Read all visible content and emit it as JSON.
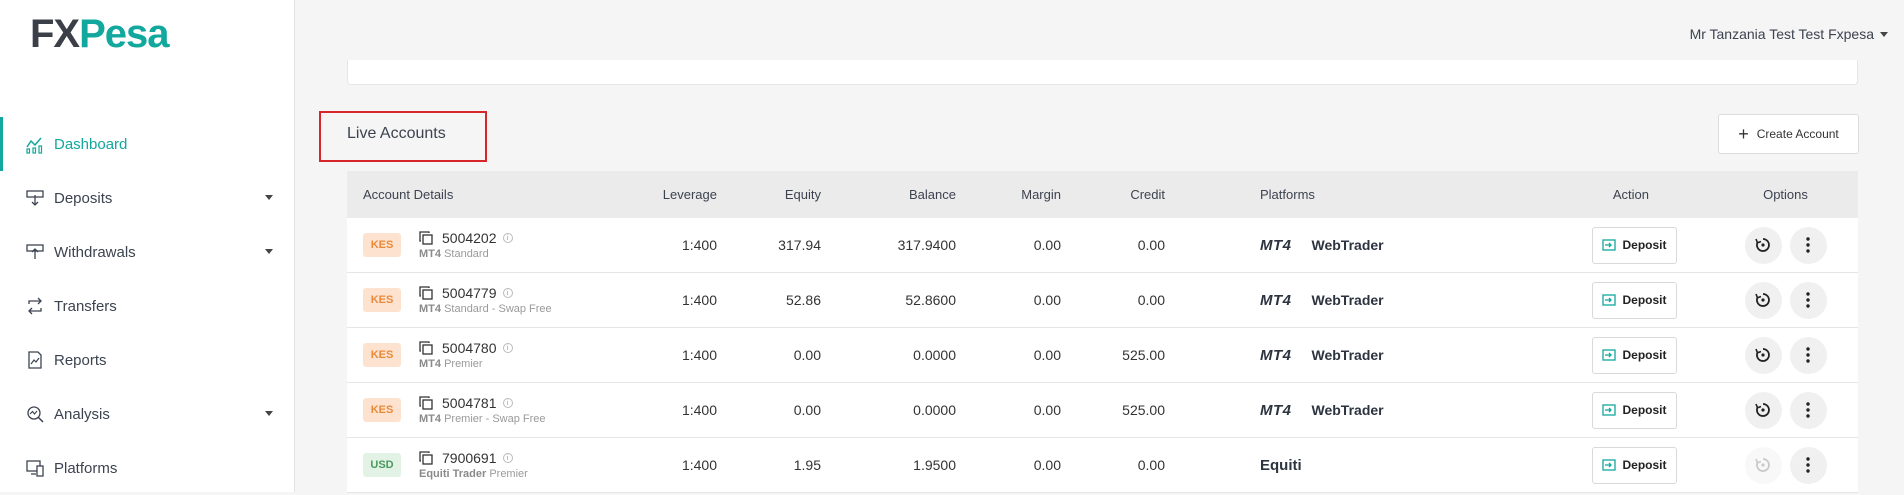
{
  "brand": {
    "logo_fx": "FX",
    "logo_pesa": "Pesa"
  },
  "user": {
    "name": "Mr Tanzania Test Test Fxpesa"
  },
  "sidebar": {
    "items": [
      {
        "label": "Dashboard",
        "icon": "dashboard-chart-icon",
        "active": true,
        "has_caret": false
      },
      {
        "label": "Deposits",
        "icon": "deposit-icon",
        "active": false,
        "has_caret": true
      },
      {
        "label": "Withdrawals",
        "icon": "withdrawal-icon",
        "active": false,
        "has_caret": true
      },
      {
        "label": "Transfers",
        "icon": "transfer-icon",
        "active": false,
        "has_caret": false
      },
      {
        "label": "Reports",
        "icon": "report-icon",
        "active": false,
        "has_caret": false
      },
      {
        "label": "Analysis",
        "icon": "analysis-icon",
        "active": false,
        "has_caret": true
      },
      {
        "label": "Platforms",
        "icon": "platforms-icon",
        "active": false,
        "has_caret": false
      }
    ]
  },
  "section": {
    "title": "Live Accounts",
    "create_button": "Create Account"
  },
  "table": {
    "headers": {
      "account": "Account Details",
      "leverage": "Leverage",
      "equity": "Equity",
      "balance": "Balance",
      "margin": "Margin",
      "credit": "Credit",
      "platforms": "Platforms",
      "action": "Action",
      "options": "Options"
    },
    "deposit_label": "Deposit",
    "rows": [
      {
        "currency": "KES",
        "account": "5004202",
        "type_prefix": "MT4",
        "type_suffix": "Standard",
        "leverage": "1:400",
        "equity": "317.94",
        "balance": "317.9400",
        "margin": "0.00",
        "credit": "0.00",
        "platform": "MT4",
        "platform_link": "WebTrader"
      },
      {
        "currency": "KES",
        "account": "5004779",
        "type_prefix": "MT4",
        "type_suffix": "Standard - Swap Free",
        "leverage": "1:400",
        "equity": "52.86",
        "balance": "52.8600",
        "margin": "0.00",
        "credit": "0.00",
        "platform": "MT4",
        "platform_link": "WebTrader"
      },
      {
        "currency": "KES",
        "account": "5004780",
        "type_prefix": "MT4",
        "type_suffix": "Premier",
        "leverage": "1:400",
        "equity": "0.00",
        "balance": "0.0000",
        "margin": "0.00",
        "credit": "525.00",
        "platform": "MT4",
        "platform_link": "WebTrader"
      },
      {
        "currency": "KES",
        "account": "5004781",
        "type_prefix": "MT4",
        "type_suffix": "Premier - Swap Free",
        "leverage": "1:400",
        "equity": "0.00",
        "balance": "0.0000",
        "margin": "0.00",
        "credit": "525.00",
        "platform": "MT4",
        "platform_link": "WebTrader"
      },
      {
        "currency": "USD",
        "account": "7900691",
        "type_prefix": "Equiti Trader",
        "type_suffix": "Premier",
        "leverage": "1:400",
        "equity": "1.95",
        "balance": "1.9500",
        "margin": "0.00",
        "credit": "0.00",
        "platform": "Equiti",
        "platform_link": ""
      }
    ]
  },
  "colors": {
    "accent": "#12a89d",
    "highlight_border": "#d6262b",
    "kes_badge": "#fde3cf",
    "usd_badge": "#e2f3e6"
  }
}
